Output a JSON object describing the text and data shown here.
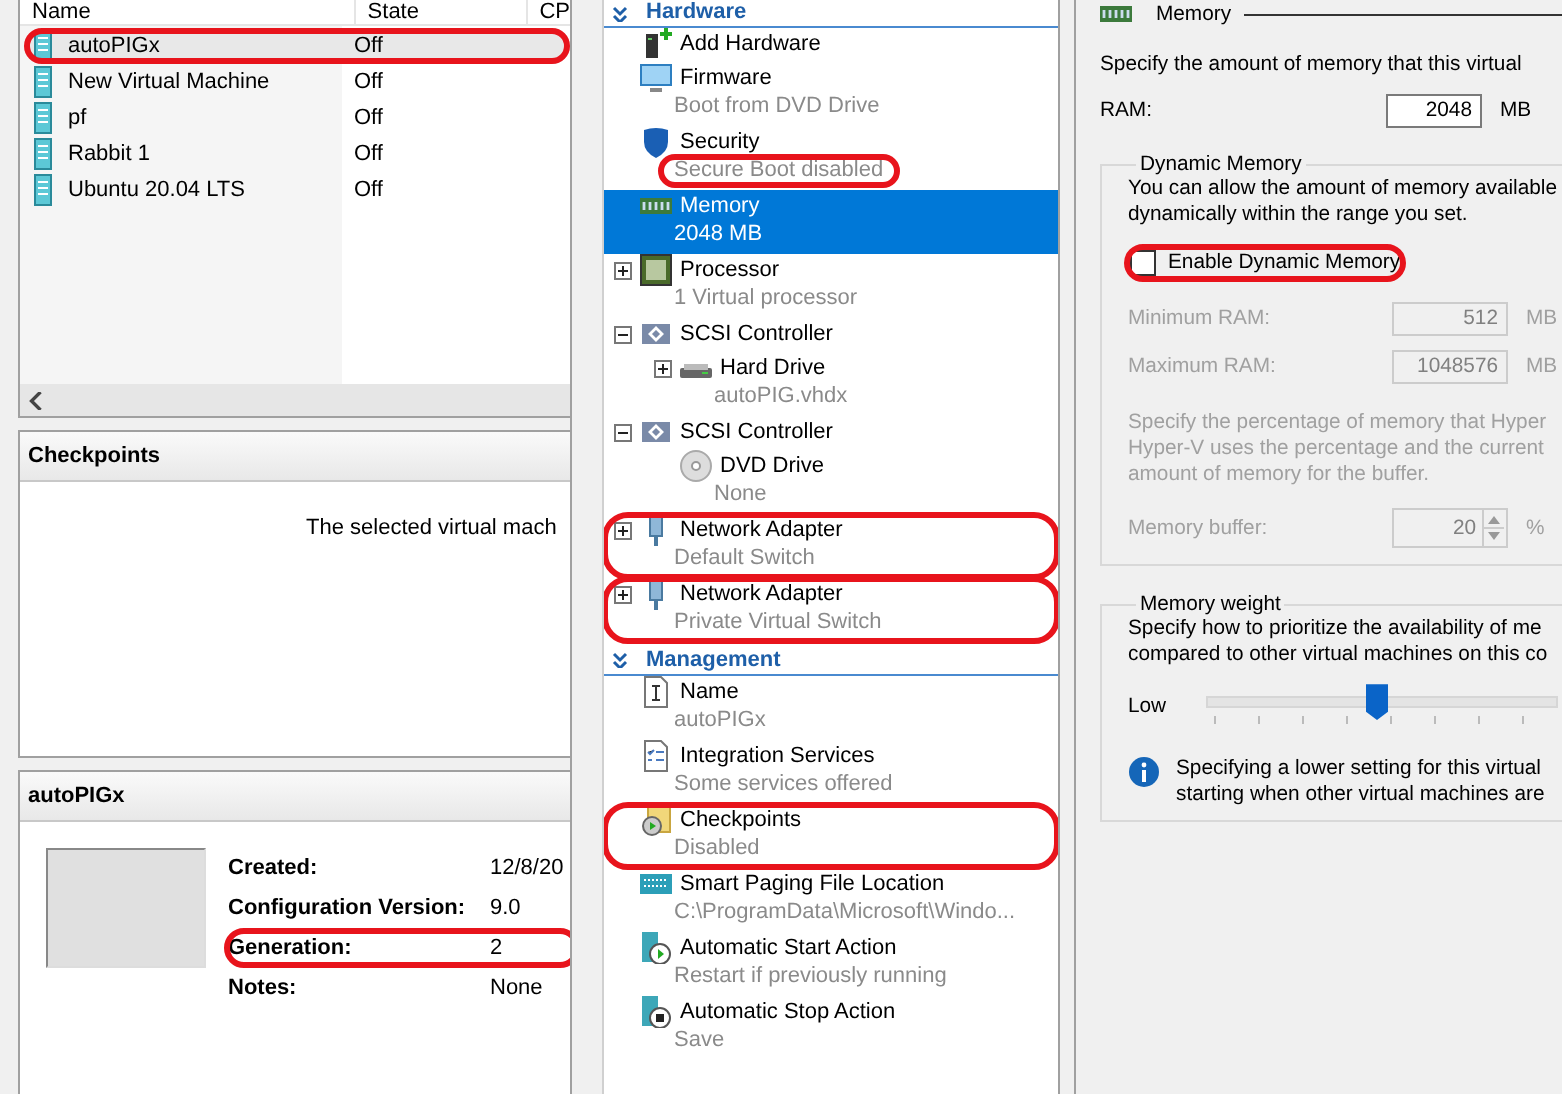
{
  "vm_list": {
    "columns": [
      "Name",
      "State",
      "CP"
    ],
    "rows": [
      {
        "name": "autoPIGx",
        "state": "Off",
        "selected": true,
        "circled": true
      },
      {
        "name": "New Virtual Machine",
        "state": "Off",
        "selected": false,
        "circled": false
      },
      {
        "name": "pf",
        "state": "Off",
        "selected": false,
        "circled": false
      },
      {
        "name": "Rabbit 1",
        "state": "Off",
        "selected": false,
        "circled": false
      },
      {
        "name": "Ubuntu 20.04 LTS",
        "state": "Off",
        "selected": false,
        "circled": false
      }
    ]
  },
  "checkpoints_pane": {
    "title": "Checkpoints",
    "message": "The selected virtual mach"
  },
  "details_pane": {
    "title": "autoPIGx",
    "fields": [
      {
        "label": "Created:",
        "value": "12/8/20",
        "circled": false
      },
      {
        "label": "Configuration Version:",
        "value": "9.0",
        "circled": false
      },
      {
        "label": "Generation:",
        "value": "2",
        "circled": true
      },
      {
        "label": "Notes:",
        "value": "None",
        "circled": false
      }
    ]
  },
  "settings_tree": {
    "sections": [
      {
        "title": "Hardware",
        "items": [
          {
            "kind": "addhardware",
            "title": "Add Hardware",
            "selected": false,
            "circled": false
          },
          {
            "kind": "firmware",
            "title": "Firmware",
            "subtitle": "Boot from DVD Drive",
            "selected": false,
            "circled": false,
            "subtitle_circled": false
          },
          {
            "kind": "security",
            "title": "Security",
            "subtitle": "Secure Boot disabled",
            "selected": false,
            "circled": false,
            "subtitle_circled": true
          },
          {
            "kind": "memory",
            "title": "Memory",
            "subtitle": "2048 MB",
            "selected": true,
            "circled": false,
            "subtitle_circled": false
          },
          {
            "kind": "processor",
            "title": "Processor",
            "subtitle": "1 Virtual processor",
            "selected": false,
            "expanded": false,
            "circled": false,
            "subtitle_circled": false
          },
          {
            "kind": "controller",
            "title": "SCSI Controller",
            "selected": false,
            "expanded": true,
            "circled": false,
            "children": [
              {
                "kind": "disk",
                "title": "Hard Drive",
                "subtitle": "autoPIG.vhdx",
                "selected": false,
                "expanded": false,
                "circled": false,
                "subtitle_circled": false
              }
            ]
          },
          {
            "kind": "controller",
            "title": "SCSI Controller",
            "selected": false,
            "expanded": true,
            "circled": false,
            "children": [
              {
                "kind": "dvd",
                "title": "DVD Drive",
                "subtitle": "None",
                "selected": false,
                "circled": false,
                "subtitle_circled": false
              }
            ]
          },
          {
            "kind": "network",
            "title": "Network Adapter",
            "subtitle": "Default Switch",
            "selected": false,
            "expanded": false,
            "circled": true,
            "subtitle_circled": false
          },
          {
            "kind": "network",
            "title": "Network Adapter",
            "subtitle": "Private Virtual Switch",
            "selected": false,
            "expanded": false,
            "circled": true,
            "subtitle_circled": false
          }
        ]
      },
      {
        "title": "Management",
        "items": [
          {
            "kind": "name",
            "title": "Name",
            "subtitle": "autoPIGx",
            "selected": false,
            "circled": false,
            "subtitle_circled": false
          },
          {
            "kind": "services",
            "title": "Integration Services",
            "subtitle": "Some services offered",
            "selected": false,
            "circled": false,
            "subtitle_circled": false
          },
          {
            "kind": "checkpoints",
            "title": "Checkpoints",
            "subtitle": "Disabled",
            "selected": false,
            "circled": true,
            "subtitle_circled": false
          },
          {
            "kind": "paging",
            "title": "Smart Paging File Location",
            "subtitle": "C:\\ProgramData\\Microsoft\\Windo...",
            "selected": false,
            "circled": false,
            "subtitle_circled": false
          },
          {
            "kind": "start",
            "title": "Automatic Start Action",
            "subtitle": "Restart if previously running",
            "selected": false,
            "circled": false,
            "subtitle_circled": false
          },
          {
            "kind": "stop",
            "title": "Automatic Stop Action",
            "subtitle": "Save",
            "selected": false,
            "circled": false,
            "subtitle_circled": false
          }
        ]
      }
    ]
  },
  "memory_page": {
    "title": "Memory",
    "intro": "Specify the amount of memory that this virtual",
    "ram": {
      "label": "RAM:",
      "value": "2048",
      "unit": "MB"
    },
    "dynamic_memory": {
      "title": "Dynamic Memory",
      "description": "You can allow the amount of memory available\ndynamically within the range you set.",
      "enable": {
        "label": "Enable Dynamic Memory",
        "checked": false,
        "circled": true
      },
      "minimum": {
        "label": "Minimum RAM:",
        "value": "512",
        "unit": "MB"
      },
      "maximum": {
        "label": "Maximum RAM:",
        "value": "1048576",
        "unit": "MB"
      },
      "buffer_description": "Specify the percentage of memory that Hyper\nHyper-V uses the percentage and the current\namount of memory for the buffer.",
      "buffer": {
        "label": "Memory buffer:",
        "value": "20",
        "unit": "%"
      }
    },
    "memory_weight": {
      "title": "Memory weight",
      "description": "Specify how to prioritize the availability of me\ncompared to other virtual machines on this co",
      "slider": {
        "label": "Low",
        "level": 0.5
      },
      "info": "Specifying a lower setting for this virtual\nstarting when other virtual machines are"
    }
  }
}
